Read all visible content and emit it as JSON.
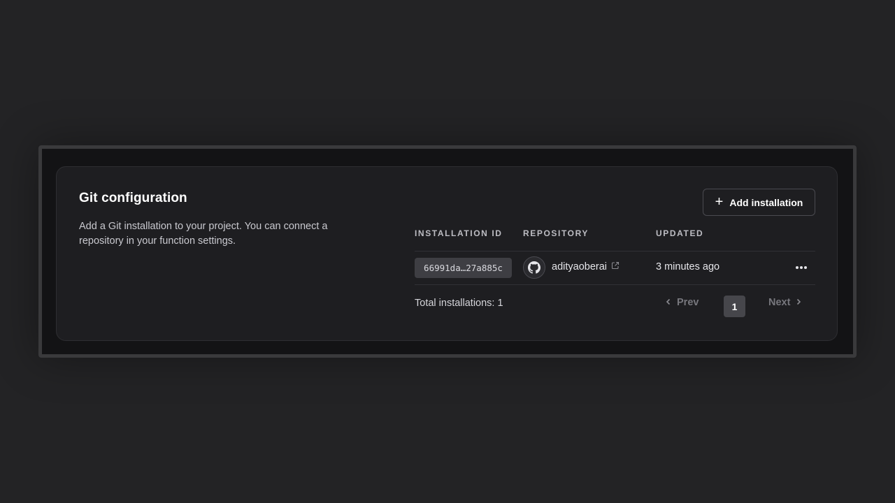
{
  "section": {
    "title": "Git configuration",
    "description": "Add a Git installation to your project. You can connect a repository in your function settings."
  },
  "actions": {
    "add_label": "Add installation",
    "add_icon": "plus-icon"
  },
  "table": {
    "headers": {
      "installation_id": "Installation ID",
      "repository": "Repository",
      "updated": "Updated"
    },
    "rows": [
      {
        "installation_id": "66991da…27a885c",
        "provider_icon": "github-icon",
        "repository": "adityaoberai",
        "repository_link_icon": "external-link-icon",
        "updated": "3 minutes ago",
        "menu_icon": "more-horizontal-icon"
      }
    ]
  },
  "footer": {
    "total": "Total installations: 1",
    "prev_label": "Prev",
    "next_label": "Next",
    "current_page": "1"
  },
  "colors": {
    "background": "#232325",
    "frame_border": "#3a3a3c",
    "card": "#1e1e21",
    "chip": "#3e3e43",
    "active_page": "#46464b",
    "muted_text": "#77777d"
  }
}
